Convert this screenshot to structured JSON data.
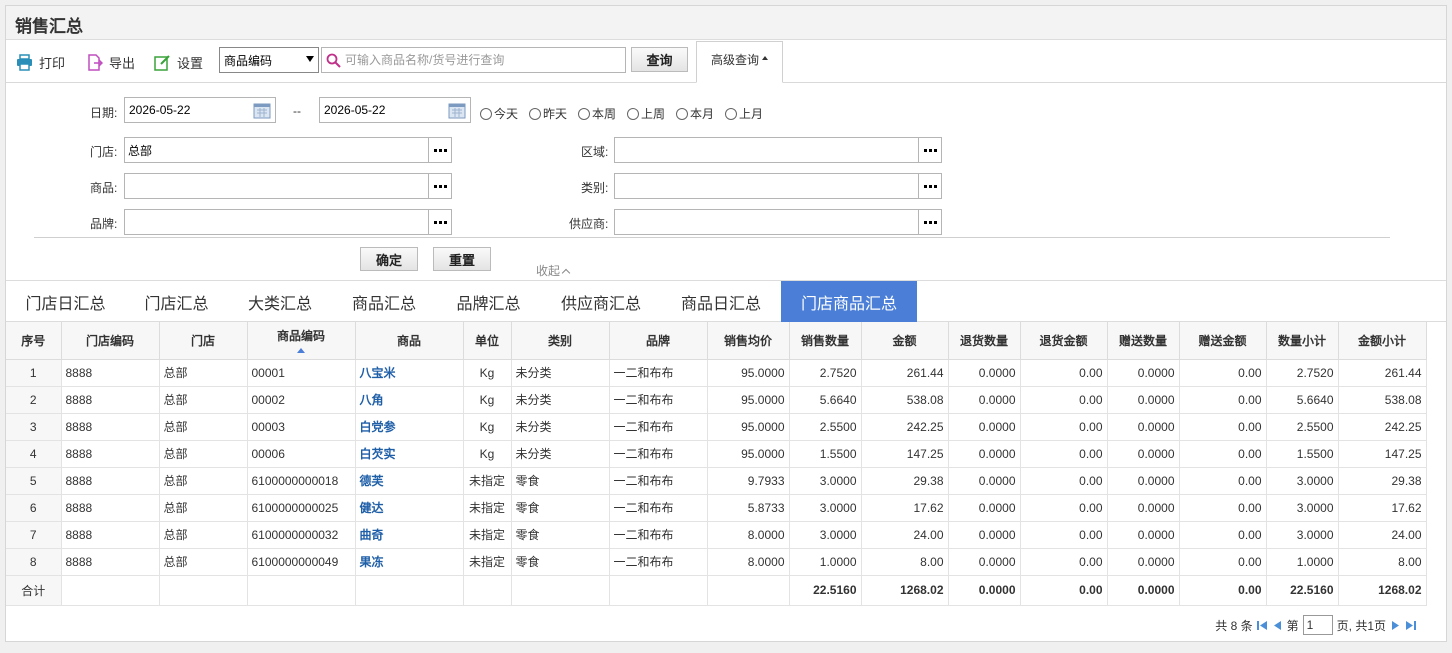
{
  "title": "销售汇总",
  "toolbar": {
    "print_label": "打印",
    "export_label": "导出",
    "settings_label": "设置",
    "search_field": "商品编码",
    "search_placeholder": "可输入商品名称/货号进行查询",
    "query_label": "查询",
    "advanced_label": "高级查询"
  },
  "filter": {
    "date_label": "日期:",
    "date_from": "2026-05-22",
    "date_sep": "--",
    "date_to": "2026-05-22",
    "quick_ranges": [
      "今天",
      "昨天",
      "本周",
      "上周",
      "本月",
      "上月"
    ],
    "store_label": "门店:",
    "store_value": "总部",
    "region_label": "区域:",
    "region_value": "",
    "product_label": "商品:",
    "product_value": "",
    "category_label": "类别:",
    "category_value": "",
    "brand_label": "品牌:",
    "brand_value": "",
    "supplier_label": "供应商:",
    "supplier_value": "",
    "confirm_label": "确定",
    "reset_label": "重置",
    "collapse_label": "收起"
  },
  "tabs": [
    {
      "label": "门店日汇总",
      "active": false
    },
    {
      "label": "门店汇总",
      "active": false
    },
    {
      "label": "大类汇总",
      "active": false
    },
    {
      "label": "商品汇总",
      "active": false
    },
    {
      "label": "品牌汇总",
      "active": false
    },
    {
      "label": "供应商汇总",
      "active": false
    },
    {
      "label": "商品日汇总",
      "active": false
    },
    {
      "label": "门店商品汇总",
      "active": true
    }
  ],
  "table": {
    "columns": [
      "序号",
      "门店编码",
      "门店",
      "商品编码",
      "商品",
      "单位",
      "类别",
      "品牌",
      "销售均价",
      "销售数量",
      "金额",
      "退货数量",
      "退货金额",
      "赠送数量",
      "赠送金额",
      "数量小计",
      "金额小计"
    ],
    "rows": [
      [
        "1",
        "8888",
        "总部",
        "00001",
        "八宝米",
        "Kg",
        "未分类",
        "一二和布布",
        "95.0000",
        "2.7520",
        "261.44",
        "0.0000",
        "0.00",
        "0.0000",
        "0.00",
        "2.7520",
        "261.44"
      ],
      [
        "2",
        "8888",
        "总部",
        "00002",
        "八角",
        "Kg",
        "未分类",
        "一二和布布",
        "95.0000",
        "5.6640",
        "538.08",
        "0.0000",
        "0.00",
        "0.0000",
        "0.00",
        "5.6640",
        "538.08"
      ],
      [
        "3",
        "8888",
        "总部",
        "00003",
        "白党参",
        "Kg",
        "未分类",
        "一二和布布",
        "95.0000",
        "2.5500",
        "242.25",
        "0.0000",
        "0.00",
        "0.0000",
        "0.00",
        "2.5500",
        "242.25"
      ],
      [
        "4",
        "8888",
        "总部",
        "00006",
        "白芡实",
        "Kg",
        "未分类",
        "一二和布布",
        "95.0000",
        "1.5500",
        "147.25",
        "0.0000",
        "0.00",
        "0.0000",
        "0.00",
        "1.5500",
        "147.25"
      ],
      [
        "5",
        "8888",
        "总部",
        "6100000000018",
        "德芙",
        "未指定",
        "零食",
        "一二和布布",
        "9.7933",
        "3.0000",
        "29.38",
        "0.0000",
        "0.00",
        "0.0000",
        "0.00",
        "3.0000",
        "29.38"
      ],
      [
        "6",
        "8888",
        "总部",
        "6100000000025",
        "健达",
        "未指定",
        "零食",
        "一二和布布",
        "5.8733",
        "3.0000",
        "17.62",
        "0.0000",
        "0.00",
        "0.0000",
        "0.00",
        "3.0000",
        "17.62"
      ],
      [
        "7",
        "8888",
        "总部",
        "6100000000032",
        "曲奇",
        "未指定",
        "零食",
        "一二和布布",
        "8.0000",
        "3.0000",
        "24.00",
        "0.0000",
        "0.00",
        "0.0000",
        "0.00",
        "3.0000",
        "24.00"
      ],
      [
        "8",
        "8888",
        "总部",
        "6100000000049",
        "果冻",
        "未指定",
        "零食",
        "一二和布布",
        "8.0000",
        "1.0000",
        "8.00",
        "0.0000",
        "0.00",
        "0.0000",
        "0.00",
        "1.0000",
        "8.00"
      ]
    ],
    "total": [
      "合计",
      "",
      "",
      "",
      "",
      "",
      "",
      "",
      "",
      "22.5160",
      "1268.02",
      "0.0000",
      "0.00",
      "0.0000",
      "0.00",
      "22.5160",
      "1268.02"
    ]
  },
  "pager": {
    "total_text": "共 8 条",
    "page_prefix": "第",
    "page_value": "1",
    "page_suffix": "页, 共1页"
  },
  "colors": {
    "accent": "#4a7ed7",
    "link": "#1f5fa8"
  }
}
